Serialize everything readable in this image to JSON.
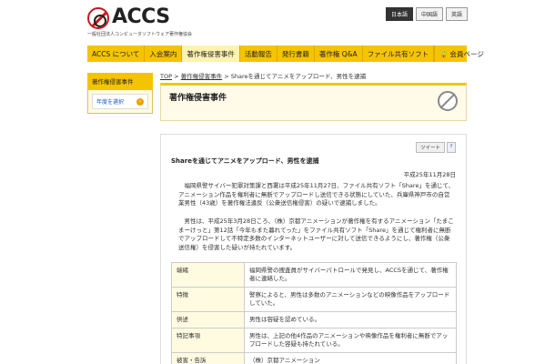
{
  "header": {
    "logo_text": "ACCS",
    "logo_sub": "一般社団法人コンピュータソフトウェア著作権協会",
    "languages": [
      {
        "label": "日本語",
        "active": true
      },
      {
        "label": "中国語",
        "active": false
      },
      {
        "label": "英語",
        "active": false
      }
    ]
  },
  "nav": {
    "items": [
      {
        "label": "ACCS について"
      },
      {
        "label": "入会案内"
      },
      {
        "label": "著作権侵害事件"
      },
      {
        "label": "活動報告"
      },
      {
        "label": "発行書籍"
      },
      {
        "label": "著作権 Q&A"
      },
      {
        "label": "ファイル共有ソフト"
      }
    ],
    "member_label": "会員ページ"
  },
  "sidebar": {
    "heading": "著作権侵害事件",
    "link_label": "年度を選択"
  },
  "breadcrumb": {
    "top": "TOP",
    "sep": ">",
    "cat": "著作権侵害事件",
    "current": "Shareを通じてアニメをアップロード、男性を逮捕"
  },
  "section": {
    "title": "著作権侵害事件"
  },
  "article": {
    "tweet_label": "ツイート",
    "fb_label": "f",
    "title": "Shareを通じてアニメをアップロード、男性を逮捕",
    "date": "平成25年11月28日",
    "para1": "福岡県警サイバー犯罪対策課と西署は平成25年11月27日、ファイル共有ソフト「Share」を通じて、アニメーション作品を権利者に無断でアップロードし送信できる状態にしていた、兵庫県神戸市の自営業男性（43歳）を著作権法違反（公衆送信権侵害）の疑いで逮捕しました。",
    "para2": "男性は、平成25年3月28日ころ、（株）京都アニメーションが著作権を有するアニメーション「たまこまーけっと」第12話「今年もまた暮れてった」をファイル共有ソフト「Share」を通じて権利者に無断でアップロードして不特定多数のインターネットユーザーに対して送信できるようにし、著作権（公衆送信権）を侵害した疑いが持たれています。",
    "table": [
      {
        "label": "端緒",
        "value": "福岡県警の捜査員がサイバーパトロールで発見し、ACCSを通じて、著作権者に連絡した。"
      },
      {
        "label": "特徴",
        "value": "警察によると、男性は多数のアニメーションなどの映像作品をアップロードしていた。"
      },
      {
        "label": "供述",
        "value": "男性は容疑を認めている。"
      },
      {
        "label": "特記事項",
        "value": "男性は、上記の他4作品のアニメーションや映像作品を権利者に無断でアップロードした容疑も持たれている。"
      },
      {
        "label": "被害・告訴",
        "value": "（株）京都アニメーション"
      }
    ]
  }
}
